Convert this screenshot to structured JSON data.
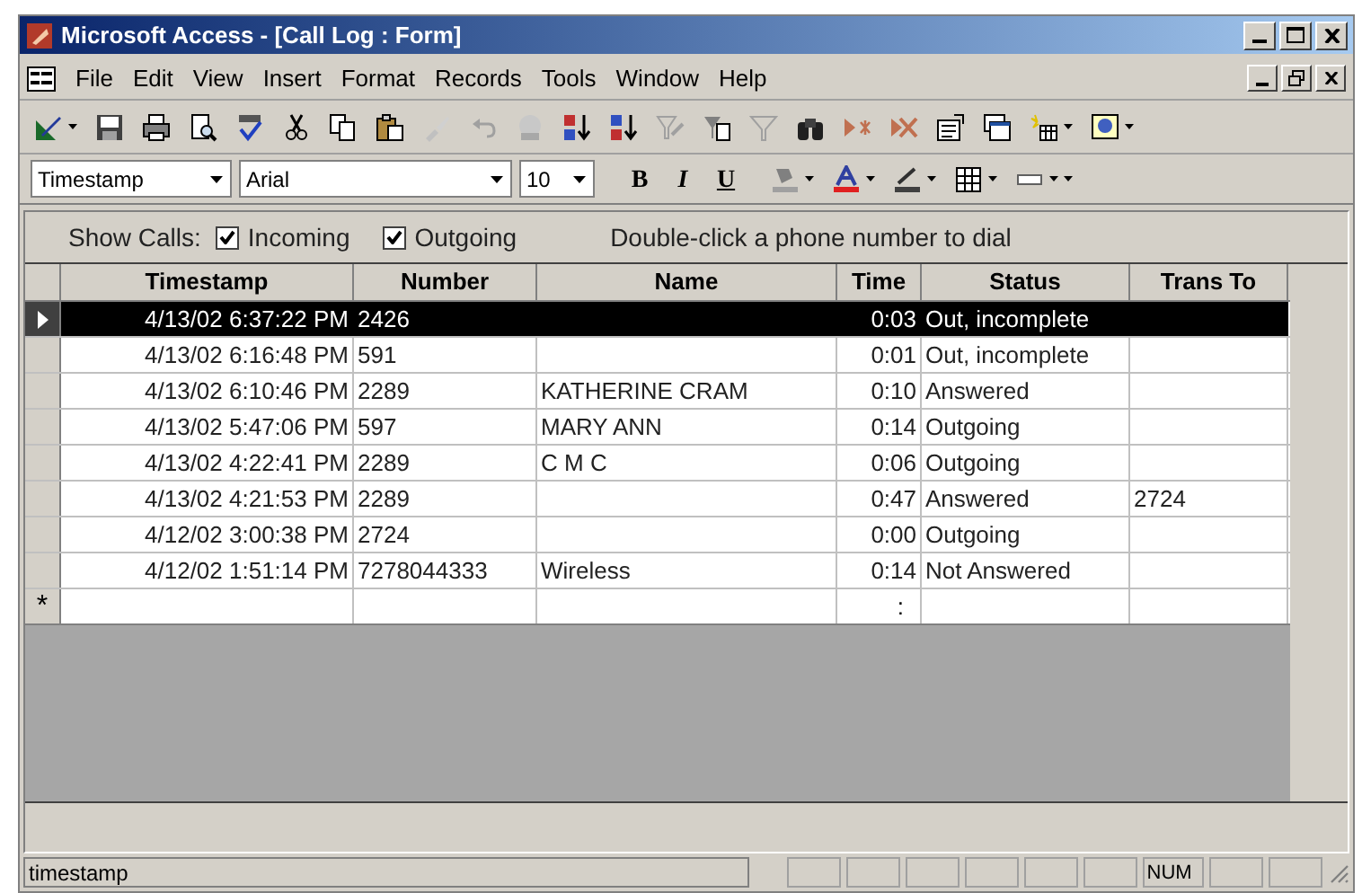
{
  "window": {
    "title": "Microsoft Access - [Call Log : Form]"
  },
  "menu": [
    "File",
    "Edit",
    "View",
    "Insert",
    "Format",
    "Records",
    "Tools",
    "Window",
    "Help"
  ],
  "format_toolbar": {
    "object": "Timestamp",
    "font": "Arial",
    "size": "10",
    "buttons": [
      "B",
      "I",
      "U"
    ]
  },
  "filter": {
    "label": "Show Calls:",
    "options": [
      {
        "label": "Incoming",
        "checked": true
      },
      {
        "label": "Outgoing",
        "checked": true
      }
    ],
    "hint": "Double-click a phone number to dial"
  },
  "table": {
    "columns": [
      "Timestamp",
      "Number",
      "Name",
      "Time",
      "Status",
      "Trans To"
    ],
    "rows": [
      {
        "selected": true,
        "cells": [
          "4/13/02 6:37:22 PM",
          "2426",
          "",
          "0:03",
          "Out, incomplete",
          ""
        ]
      },
      {
        "selected": false,
        "cells": [
          "4/13/02 6:16:48 PM",
          "591",
          "",
          "0:01",
          "Out, incomplete",
          ""
        ]
      },
      {
        "selected": false,
        "cells": [
          "4/13/02 6:10:46 PM",
          "2289",
          "KATHERINE CRAM",
          "0:10",
          "Answered",
          ""
        ]
      },
      {
        "selected": false,
        "cells": [
          "4/13/02 5:47:06 PM",
          "597",
          "MARY ANN",
          "0:14",
          "Outgoing",
          ""
        ]
      },
      {
        "selected": false,
        "cells": [
          "4/13/02 4:22:41 PM",
          "2289",
          "C M C",
          "0:06",
          "Outgoing",
          ""
        ]
      },
      {
        "selected": false,
        "cells": [
          "4/13/02 4:21:53 PM",
          "2289",
          "",
          "0:47",
          "Answered",
          "2724"
        ]
      },
      {
        "selected": false,
        "cells": [
          "4/12/02 3:00:38 PM",
          "2724",
          "",
          "0:00",
          "Outgoing",
          ""
        ]
      },
      {
        "selected": false,
        "cells": [
          "4/12/02 1:51:14 PM",
          "7278044333",
          "Wireless",
          "0:14",
          "Not Answered",
          ""
        ]
      }
    ],
    "new_row": {
      "marker": "*",
      "time_mask": ":"
    }
  },
  "status_bar": {
    "text": "timestamp",
    "indicators": [
      "NUM"
    ]
  }
}
